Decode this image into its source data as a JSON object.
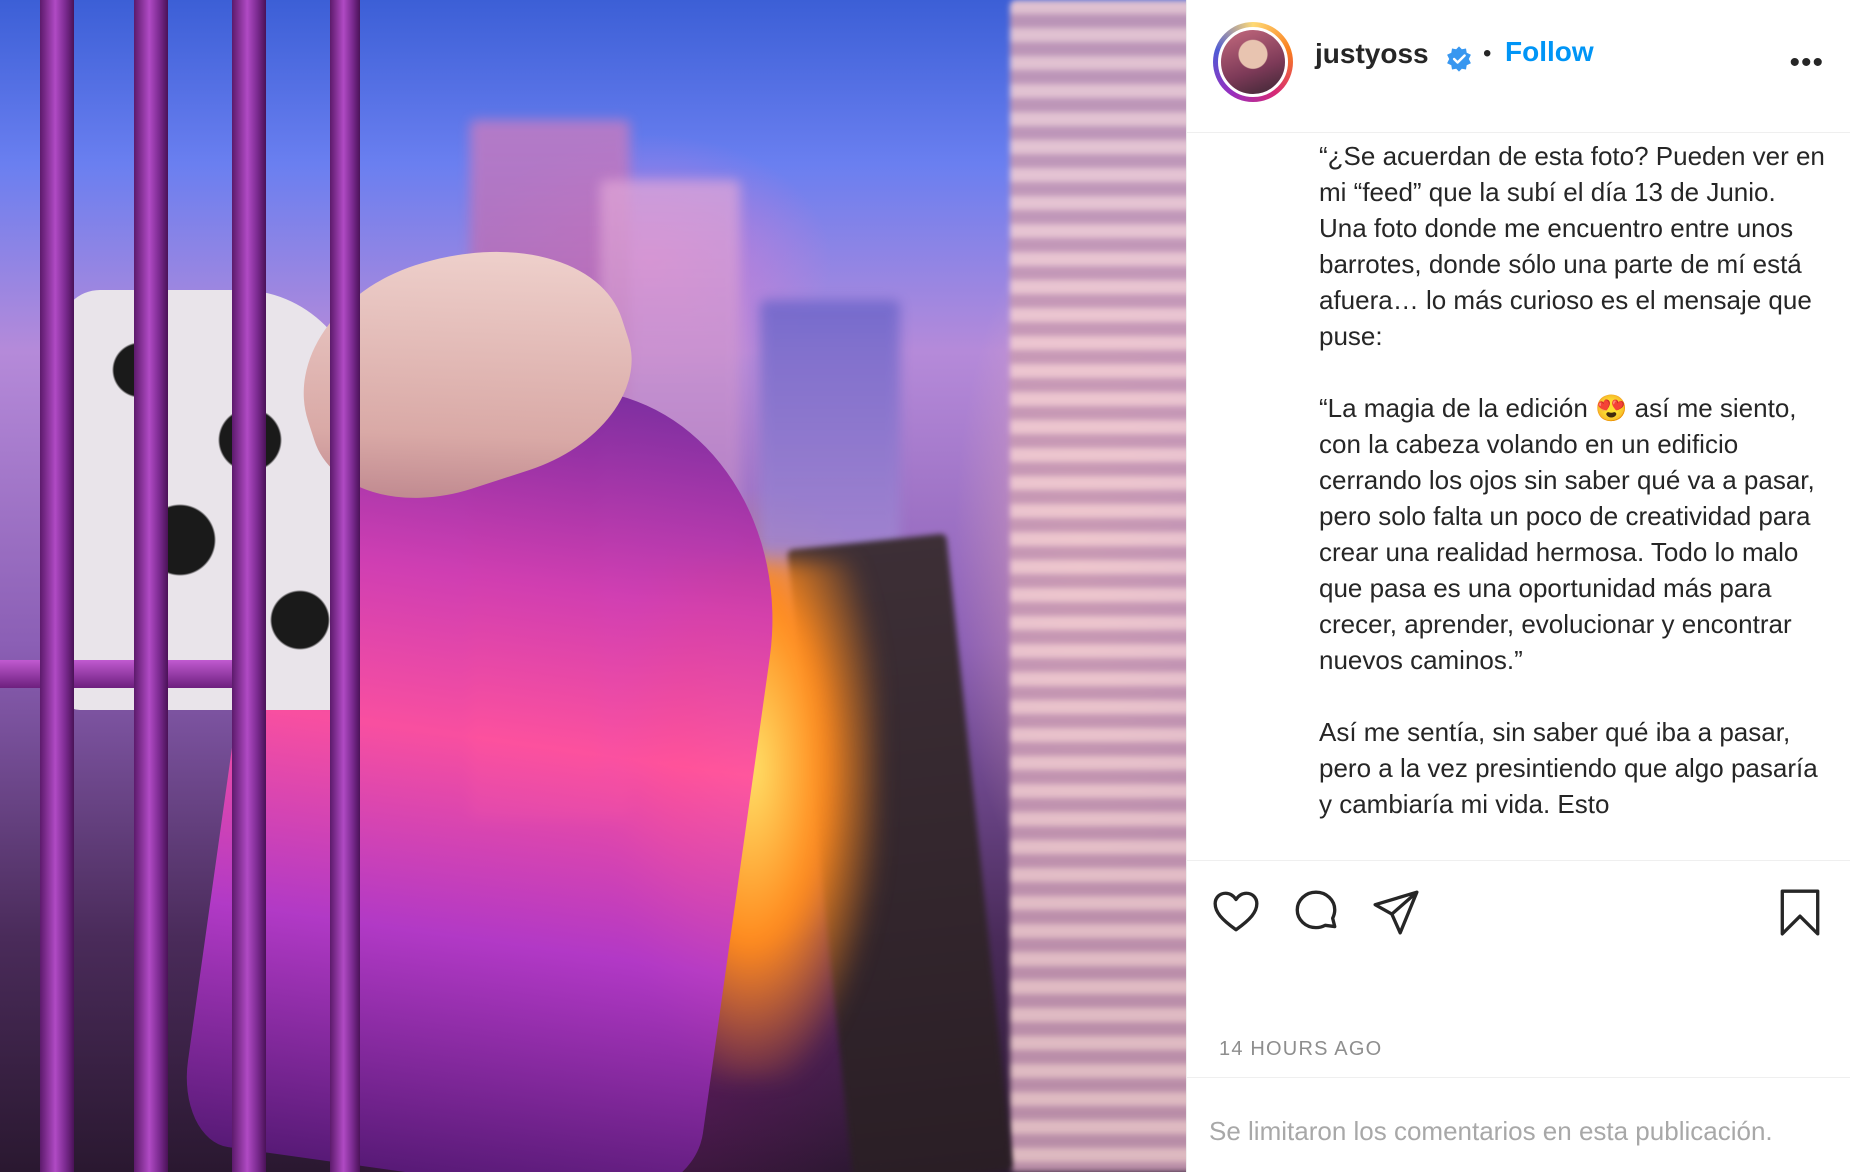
{
  "post": {
    "image_alt": "Woman with pink hair leaning through balcony bars over a neon city",
    "header": {
      "username": "justyoss",
      "verified_icon": "verified-badge-icon",
      "separator": "•",
      "follow_label": "Follow",
      "more_label": "•••"
    },
    "caption": "“¿Se acuerdan de esta foto? Pueden ver en mi “feed” que la subí el día 13 de Junio. Una foto donde me encuentro entre unos barrotes, donde sólo una parte de mí está afuera… lo más curioso es el mensaje que puse:\n\n“La magia de la edición 😍 así me siento, con la cabeza volando en un edificio cerrando los ojos sin saber qué va a pasar, pero solo falta un poco de creatividad para crear una realidad hermosa. Todo lo malo que pasa es una oportunidad más para crecer, aprender, evolucionar y encontrar nuevos caminos.”\n\nAsí me sentía, sin saber qué iba a pasar, pero a la vez presintiendo que algo pasaría y cambiaría mi vida. Esto",
    "actions": {
      "like": "heart-icon",
      "comment": "comment-icon",
      "share": "paper-plane-icon",
      "save": "bookmark-icon"
    },
    "timestamp": "14 HOURS AGO",
    "comments_limited": "Se limitaron los comentarios en esta publicación."
  },
  "colors": {
    "accent": "#0095f6",
    "text": "#262626",
    "muted": "#8e8e8e"
  }
}
